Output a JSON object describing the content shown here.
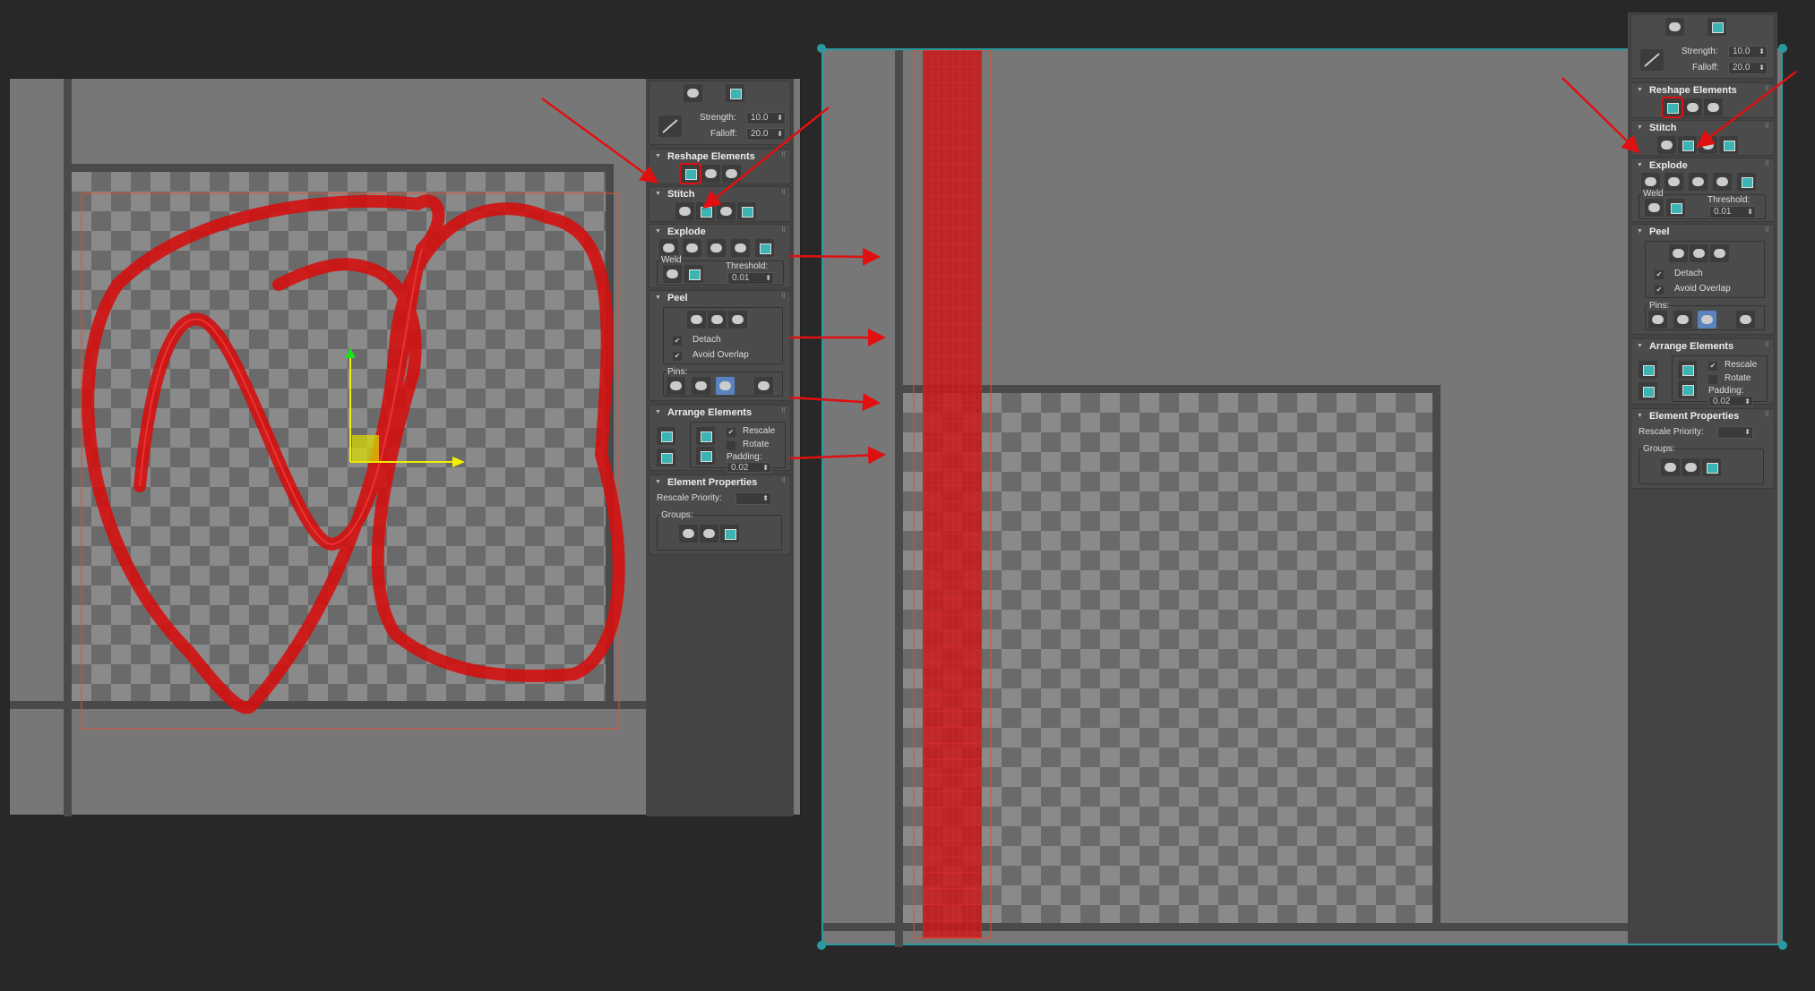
{
  "colors": {
    "accent": "#3cb4b4",
    "selection": "#e01010",
    "gizmo_x": "#f0f000",
    "gizmo_y": "#20e020",
    "frame": "#2a9aa0"
  },
  "panel": {
    "top": {
      "strength_label": "Strength:",
      "strength_value": "10.0",
      "falloff_label": "Falloff:",
      "falloff_value": "20.0"
    },
    "reshape": {
      "title": "Reshape Elements"
    },
    "stitch": {
      "title": "Stitch"
    },
    "explode": {
      "title": "Explode",
      "weld_label": "Weld",
      "threshold_label": "Threshold:",
      "threshold_value": "0.01"
    },
    "peel": {
      "title": "Peel",
      "detach_label": "Detach",
      "detach_checked": true,
      "avoid_overlap_label": "Avoid Overlap",
      "avoid_overlap_checked": true,
      "pins_label": "Pins:"
    },
    "arrange": {
      "title": "Arrange Elements",
      "rescale_label": "Rescale",
      "rescale_checked": true,
      "rotate_label": "Rotate",
      "rotate_checked": false,
      "padding_label": "Padding:",
      "padding_value": "0.02"
    },
    "props": {
      "title": "Element Properties",
      "rescale_priority_label": "Rescale Priority:",
      "rescale_priority_value": "",
      "groups_label": "Groups:"
    }
  }
}
